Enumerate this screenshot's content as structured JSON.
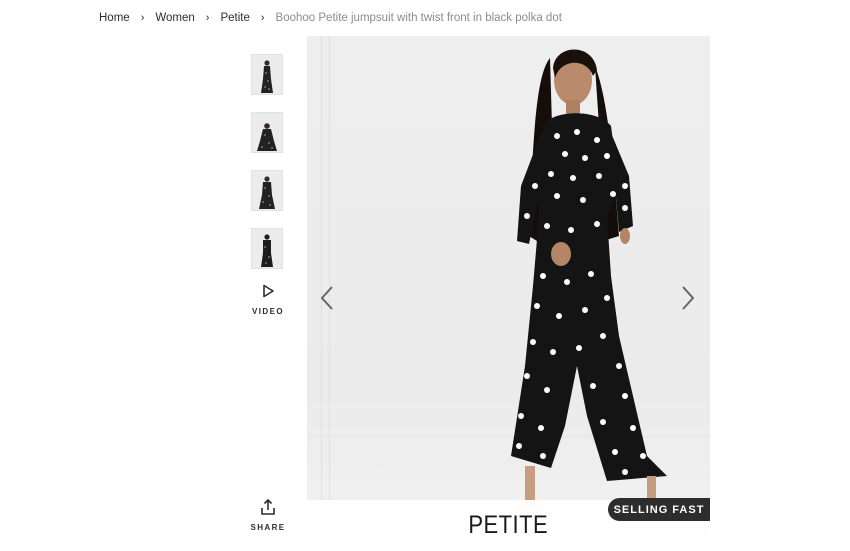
{
  "breadcrumb": {
    "items": [
      {
        "label": "Home"
      },
      {
        "label": "Women"
      },
      {
        "label": "Petite"
      }
    ],
    "current": "Boohoo Petite jumpsuit with twist front in black polka dot"
  },
  "gallery": {
    "thumbnail_count": 4,
    "video_label": "VIDEO",
    "share_label": "SHARE",
    "banner_text": "PETITE",
    "badge_text": "SELLING FAST"
  },
  "icons": {
    "prev": "chevron-left-icon",
    "next": "chevron-right-icon",
    "video": "play-icon",
    "share": "share-icon"
  },
  "colors": {
    "text": "#2d2d2d",
    "muted": "#8c8c8c",
    "badge_bg": "#2d2d2d",
    "badge_text": "#ffffff"
  }
}
